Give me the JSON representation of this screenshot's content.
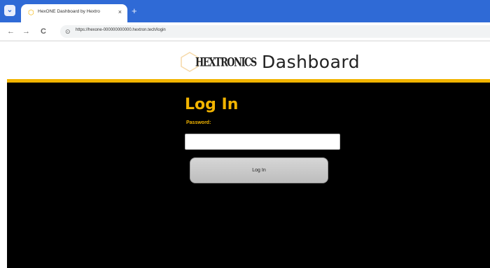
{
  "browser": {
    "tab_title": "HexONE Dashboard by Hextro",
    "tab_close": "×",
    "new_tab": "+",
    "back": "←",
    "forward": "→",
    "reload": "C",
    "site_info": "⊙",
    "url": "https://hexone-000000000000.hextron.tech/login"
  },
  "header": {
    "logo_text": "HEXTRONICS",
    "title": "Dashboard"
  },
  "login": {
    "heading": "Log In",
    "password_label": "Password:",
    "password_value": "",
    "button_label": "Log In"
  },
  "colors": {
    "accent": "#f2b400",
    "background": "#000000",
    "tabbar": "#2f6ad6"
  }
}
